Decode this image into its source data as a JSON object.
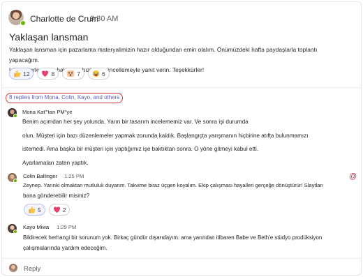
{
  "post": {
    "author": "Charlotte de Crum",
    "time": "9:30 AM",
    "title": "Yaklaşan lansman",
    "body_line1": "Yaklaşan lansman için pazarlama materyalimizin hazır olduğundan emin olalım. Önümüzdeki hafta paydaşlarla toplantı yapacağım.",
    "body_line2": "Lütfen ilerlemeniz hakkında hızlı bir güncellemeyle yanıt verin. Teşekkürler!",
    "reactions": [
      {
        "icon": "thumbs-up-icon",
        "count": "12"
      },
      {
        "icon": "heart-icon",
        "count": "8"
      },
      {
        "icon": "surprised-face-icon",
        "count": "7"
      },
      {
        "icon": "laughing-face-icon",
        "count": "6"
      }
    ]
  },
  "thread": {
    "replies_link": "8 replies from Mona, Colin, Kayo, and others"
  },
  "replies": [
    {
      "author": "Mona Kat\"'tan PM\"ye",
      "time": "",
      "lines": [
        "Benim açımdan her şey yolunda. Yarın bir tasarım incelememiz var. Ve sonra işi durumda",
        "olun. Müşteri için bazı düzenlemeler yapmak zorunda kaldık. Başlangıçta yarışmanın hiçbirine atıfta bulunmamızı",
        "istemedi. Ama başka bir müşteri için yaptığımız işe baktıktan sonra. O yöne gitmeyi kabul etti.",
        "Ayarlamaları zaten yaptık."
      ]
    },
    {
      "author": "Colin Ballinger",
      "time": "1:25 PM",
      "lines": [
        "Zeynep. Yarınki olmaktan mutluluk duyarım. Takvime biraz üçgen koyalım. Ekip çalışması hayalleri gerçeğe dönüştürür! Slaytları",
        "bana gönderebilir misiniz?"
      ],
      "reactions": [
        {
          "icon": "thumbs-up-icon",
          "count": "5"
        },
        {
          "icon": "heart-icon",
          "count": "2"
        }
      ]
    },
    {
      "author": "Kayo Miwa",
      "time": "1:29 PM",
      "lines": [
        "Bildirecek herhangi bir sorunum yok. Birkaç gündür dışarıdayım. ama yarından itibaren Babe ve Beth'e stüdyo prodüksiyon",
        "çalışmalarında yardım edeceğim."
      ]
    }
  ],
  "reply_bar": {
    "placeholder": "Reply"
  },
  "colors": {
    "accent": "#5b5fc7",
    "highlight_ring": "#d13438",
    "presence": "#6bb700",
    "mention": "#c4314b",
    "heart": "#e43e6a"
  }
}
